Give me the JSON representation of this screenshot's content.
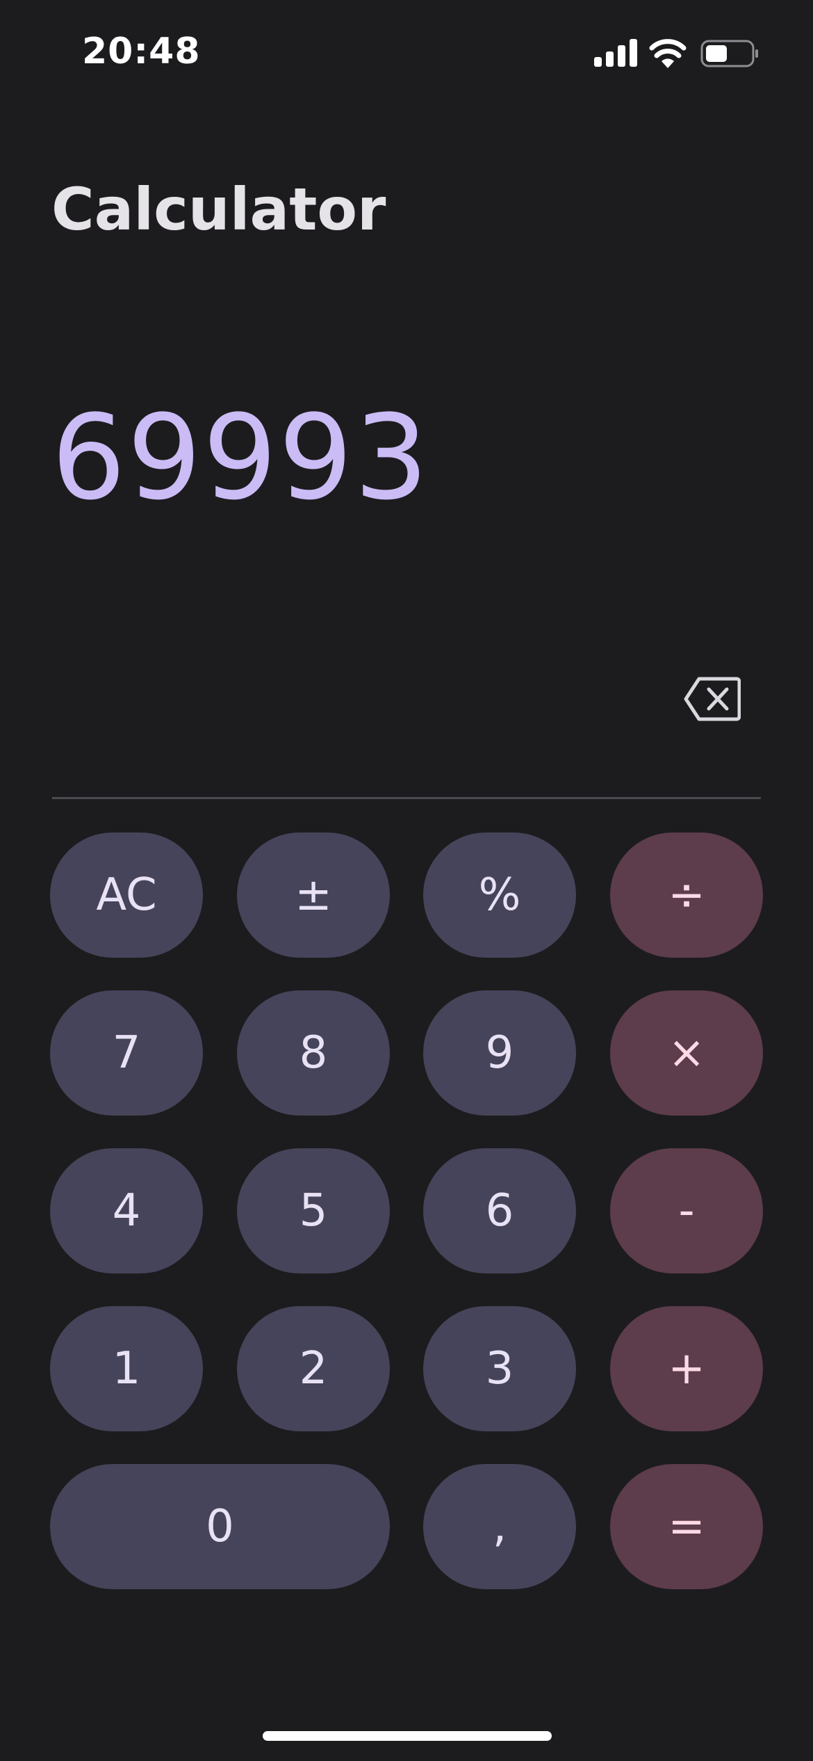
{
  "status_bar": {
    "time": "20:48",
    "icons": [
      "signal-icon",
      "wifi-icon",
      "battery-icon"
    ]
  },
  "app": {
    "title": "Calculator"
  },
  "display": {
    "value": "69993",
    "color": "#cbbcf6"
  },
  "backspace": {
    "icon": "backspace-icon"
  },
  "keys": {
    "ac": "AC",
    "plus_minus": "±",
    "percent": "%",
    "divide": "÷",
    "seven": "7",
    "eight": "8",
    "nine": "9",
    "multiply": "×",
    "four": "4",
    "five": "5",
    "six": "6",
    "minus": "-",
    "one": "1",
    "two": "2",
    "three": "3",
    "plus": "+",
    "zero": "0",
    "comma": ",",
    "equals": "="
  },
  "colors": {
    "background": "#1c1c1e",
    "number_key": "#46445a",
    "operator_key": "#5d3c4b"
  }
}
